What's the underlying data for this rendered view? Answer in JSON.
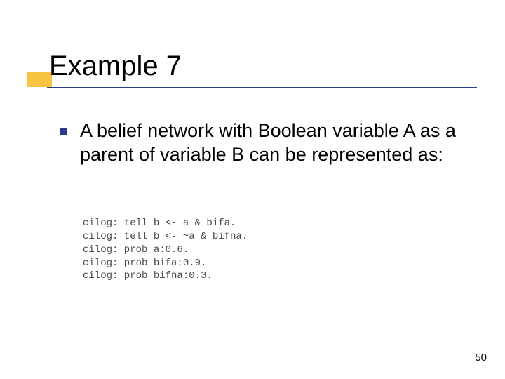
{
  "slide": {
    "title": "Example 7",
    "bullet": "A belief network with Boolean variable A as a parent of variable B can be represented as:",
    "code": {
      "l1": "cilog: tell b <- a & bifa.",
      "l2": "cilog: tell b <- ~a & bifna.",
      "l3": "cilog: prob a:0.6.",
      "l4": "cilog: prob bifa:0.9.",
      "l5": "cilog: prob bifna:0.3."
    },
    "page_number": "50"
  }
}
